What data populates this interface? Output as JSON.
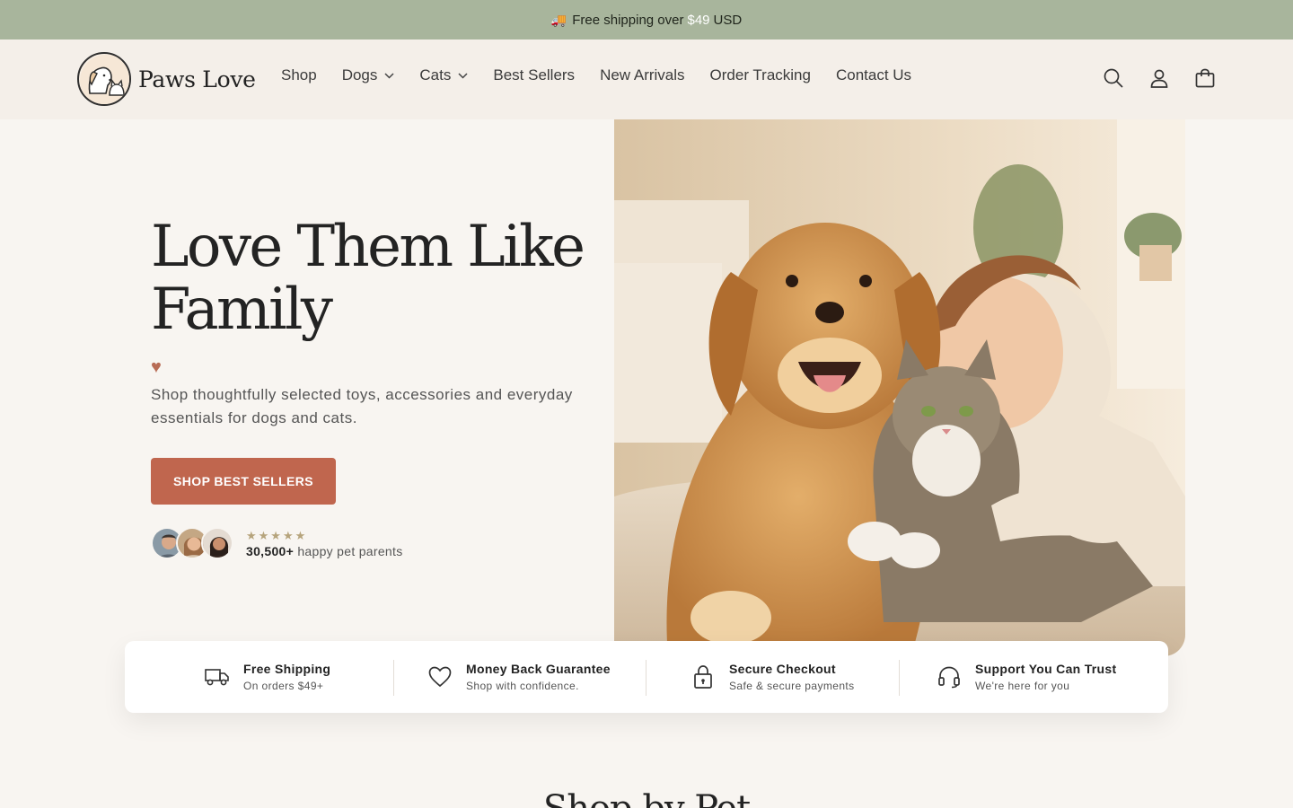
{
  "announcement": {
    "prefix": "Free shipping over",
    "price": "$49",
    "suffix": "USD",
    "icon": "truck-emoji-icon"
  },
  "brand": {
    "name": "Paws Love"
  },
  "nav": [
    {
      "label": "Shop",
      "dropdown": false
    },
    {
      "label": "Dogs",
      "dropdown": true
    },
    {
      "label": "Cats",
      "dropdown": true
    },
    {
      "label": "Best Sellers",
      "dropdown": false
    },
    {
      "label": "New Arrivals",
      "dropdown": false
    },
    {
      "label": "Order Tracking",
      "dropdown": false
    },
    {
      "label": "Contact Us",
      "dropdown": false
    }
  ],
  "header_icons": [
    "search-icon",
    "account-icon",
    "cart-icon"
  ],
  "hero": {
    "title": "Love Them Like Family",
    "heart": "♥",
    "subtitle": "Shop thoughtfully selected toys, accessories and everyday essentials for dogs and cats.",
    "cta": "SHOP BEST SELLERS",
    "rating_stars": "★★★★★",
    "rating": 5,
    "parents_count": "30,500+",
    "parents_text": "happy pet parents",
    "image_alt": "Golden retriever, girl and tabby cat cuddling on a cozy beige rug"
  },
  "trust": [
    {
      "title": "Free Shipping",
      "subtitle": "On orders $49+",
      "icon": "truck-icon"
    },
    {
      "title": "Money Back Guarantee",
      "subtitle": "Shop with confidence.",
      "icon": "heart-icon"
    },
    {
      "title": "Secure Checkout",
      "subtitle": "Safe & secure payments",
      "icon": "lock-icon"
    },
    {
      "title": "Support You Can Trust",
      "subtitle": "We're here for you",
      "icon": "headset-icon"
    }
  ],
  "next_section": {
    "title": "Shop by Pet"
  },
  "colors": {
    "accent": "#c0664e",
    "banner": "#a8b59c",
    "header_bg": "#f4efe9",
    "page_bg": "#f8f5f1"
  }
}
